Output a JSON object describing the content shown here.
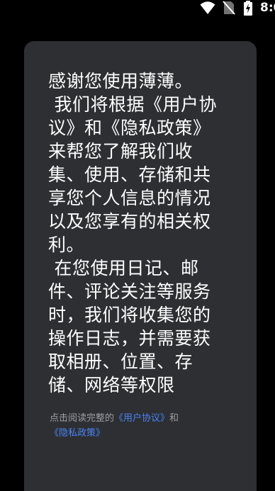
{
  "status_bar": {
    "time": "8:0",
    "icons": [
      "wifi-icon",
      "no-sim-icon",
      "battery-charging-icon"
    ]
  },
  "dialog": {
    "paragraphs": [
      "感谢您使用薄薄。",
      " 我们将根据《用户协议》和《隐私政策》来帮您了解我们收集、使用、存储和共享您个人信息的情况以及您享有的相关权利。",
      " 在您使用日记、邮件、评论关注等服务时，我们将收集您的操作日志，并需要获取相册、位置、存储、网络等权限"
    ],
    "footer": {
      "prefix": "点击阅读完整的",
      "user_agreement_link": "《用户协议》",
      "conjunction": "和",
      "privacy_policy_link": "《隐私政策》"
    }
  },
  "colors": {
    "background": "#000000",
    "dialog_bg": "#2d2f33",
    "text": "#ffffff",
    "muted_text": "#9c9ea3",
    "link": "#4a84f5"
  }
}
